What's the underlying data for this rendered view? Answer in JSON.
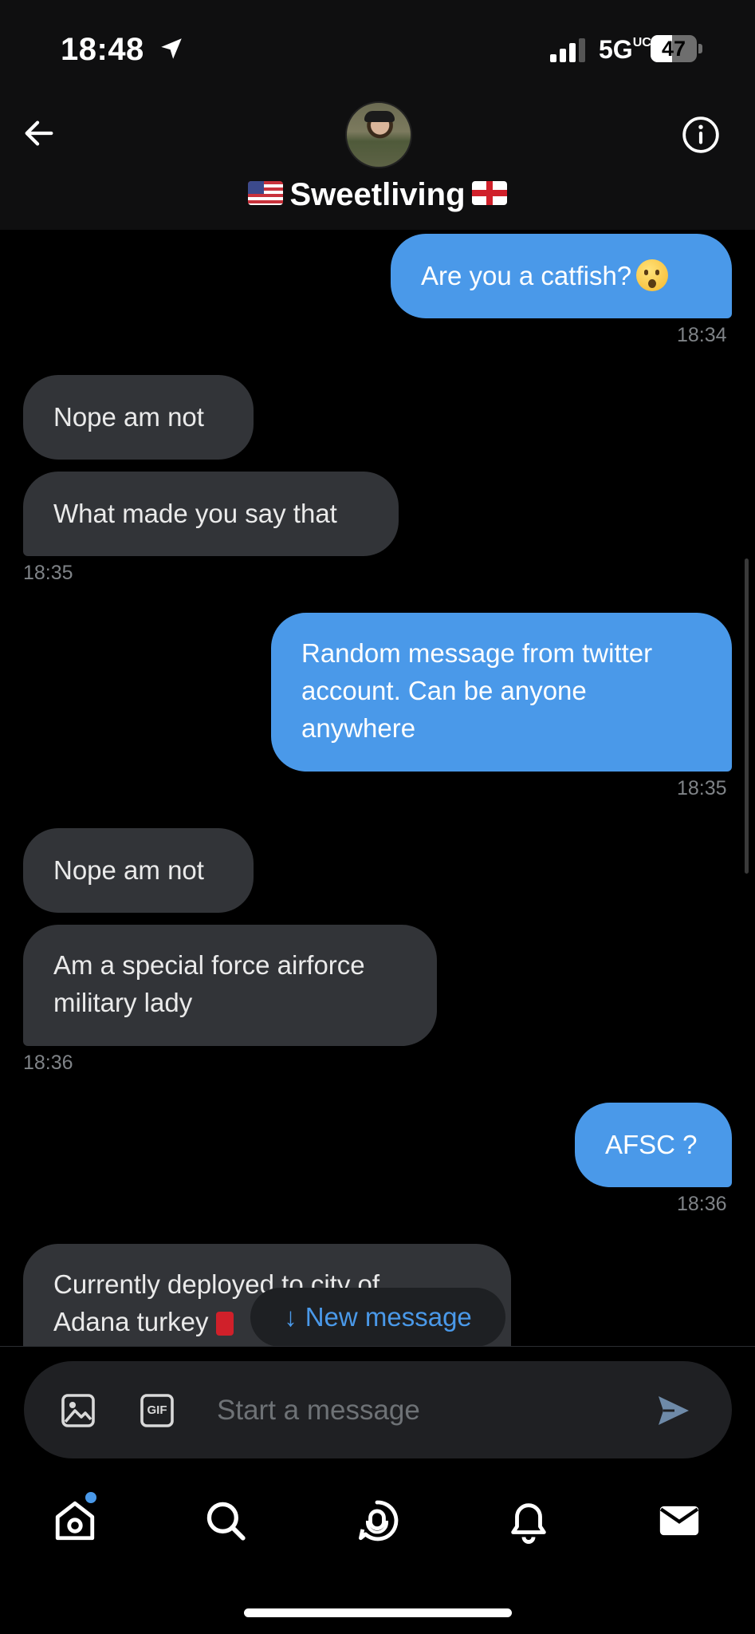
{
  "status_bar": {
    "time": "18:48",
    "network": "5G",
    "network_sup": "UC",
    "battery": "47",
    "battery_level": 0.47
  },
  "header": {
    "contact_name": "Sweetliving"
  },
  "messages": [
    {
      "side": "sent",
      "text": "Are you a catfish?",
      "time": "18:34"
    },
    {
      "side": "received",
      "text": "Nope am not"
    },
    {
      "side": "received",
      "text": "What made you say that",
      "time": "18:35"
    },
    {
      "side": "sent",
      "lines": [
        "Random message from twitter",
        "account. Can be anyone",
        "anywhere"
      ],
      "time": "18:35"
    },
    {
      "side": "received",
      "text": "Nope am not"
    },
    {
      "side": "received",
      "lines": [
        "Am a special force airforce",
        "military lady"
      ],
      "time": "18:36"
    },
    {
      "side": "sent",
      "text": "AFSC ?",
      "time": "18:36"
    },
    {
      "side": "received",
      "lines": [
        "Currently deployed to city of",
        "Adana turkey"
      ]
    }
  ],
  "new_message_pill": {
    "label": "New message"
  },
  "composer": {
    "placeholder": "Start a message",
    "gif_label": "GIF"
  },
  "nav_icons": [
    "home-icon",
    "search-icon",
    "spaces-icon",
    "notifications-icon",
    "messages-icon"
  ],
  "colors": {
    "accent": "#4A99E9",
    "bubble_received": "#323438",
    "background": "#000000"
  }
}
